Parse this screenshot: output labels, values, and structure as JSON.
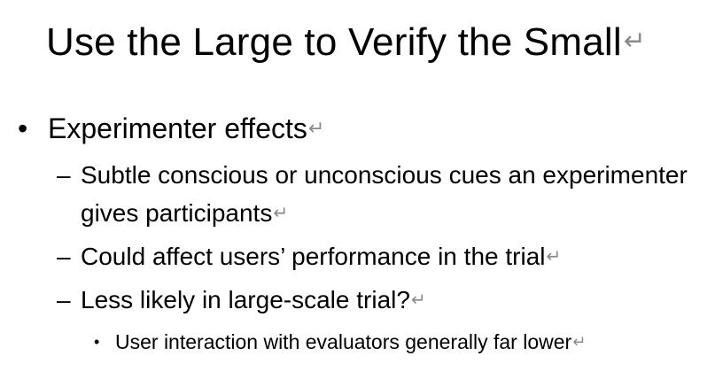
{
  "slide": {
    "title": "Use the Large to Verify the Small",
    "paragraph_mark": "↵",
    "bullet_l1": {
      "symbol": "•",
      "text": "Experimenter effects"
    },
    "bullets_l2": [
      {
        "symbol": "–",
        "text": "Subtle conscious or unconscious cues an experimenter gives participants"
      },
      {
        "symbol": "–",
        "text": "Could affect users’ performance in the trial"
      },
      {
        "symbol": "–",
        "text": "Less likely in large-scale trial?"
      }
    ],
    "bullet_l3": {
      "symbol": "•",
      "text": "User interaction with evaluators generally far lower"
    }
  }
}
